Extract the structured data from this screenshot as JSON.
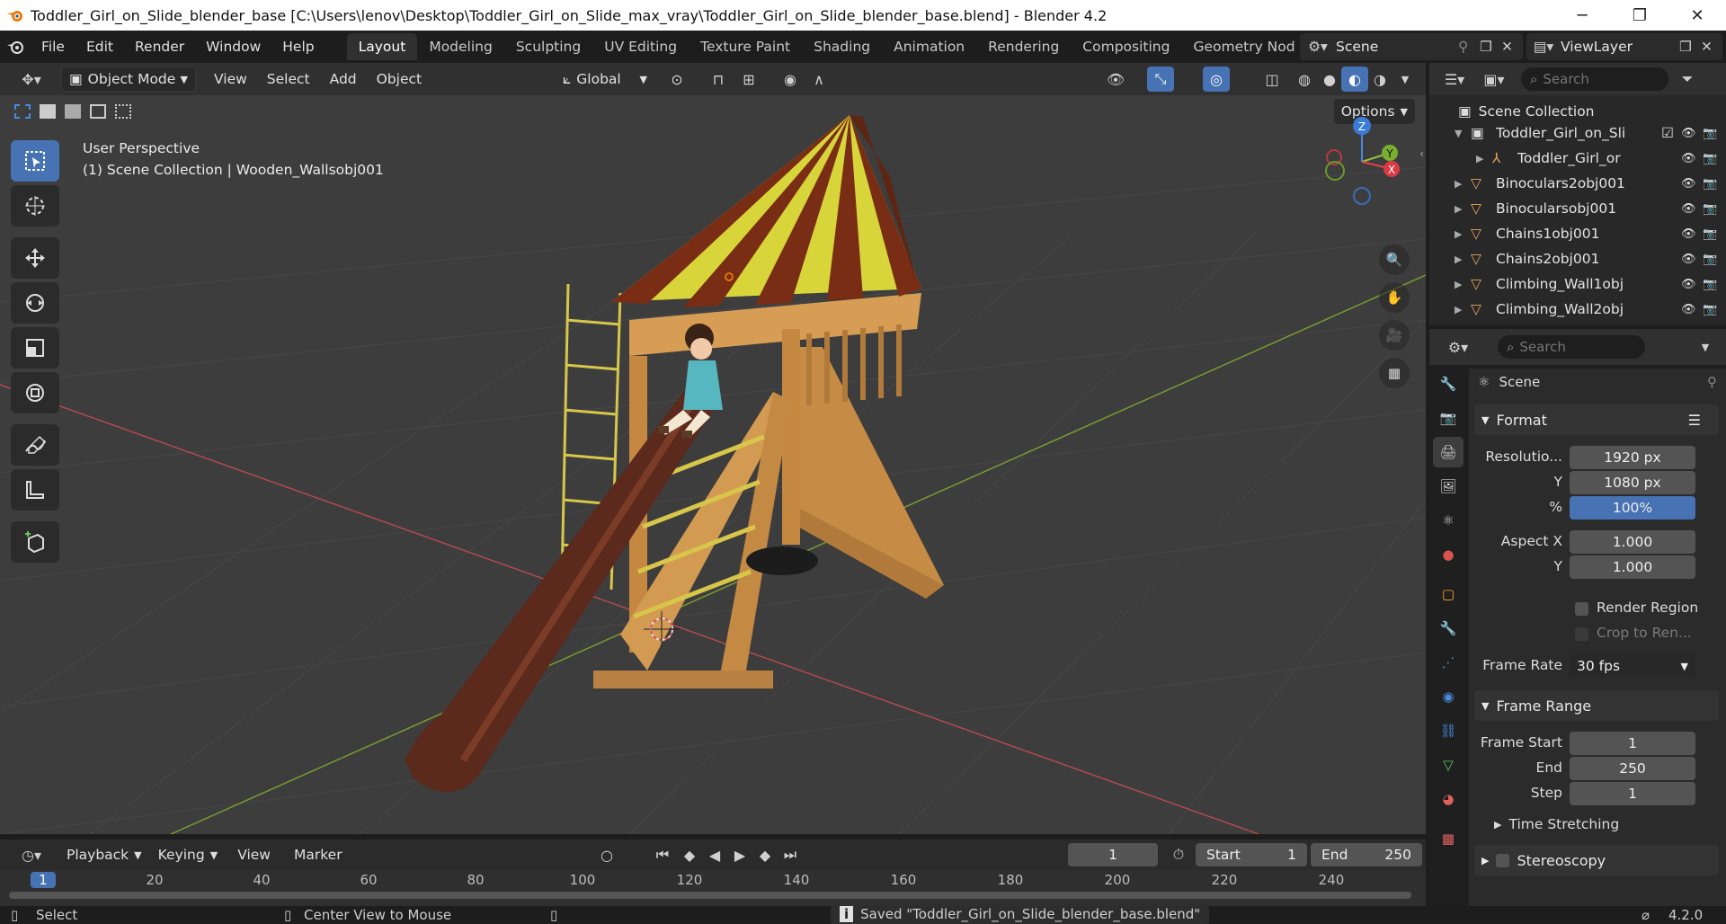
{
  "window": {
    "title": "Toddler_Girl_on_Slide_blender_base [C:\\Users\\lenov\\Desktop\\Toddler_Girl_on_Slide_max_vray\\Toddler_Girl_on_Slide_blender_base.blend] - Blender 4.2",
    "minimize": "─",
    "maximize": "❐",
    "close": "✕"
  },
  "menus": [
    "File",
    "Edit",
    "Render",
    "Window",
    "Help"
  ],
  "workspaces": [
    "Layout",
    "Modeling",
    "Sculpting",
    "UV Editing",
    "Texture Paint",
    "Shading",
    "Animation",
    "Rendering",
    "Compositing",
    "Geometry Nod"
  ],
  "active_workspace": "Layout",
  "scene_name": "Scene",
  "view_layer": "ViewLayer",
  "viewport_header": {
    "mode": "Object Mode",
    "menus": [
      "View",
      "Select",
      "Add",
      "Object"
    ],
    "orientation": "Global",
    "options": "Options"
  },
  "viewport": {
    "perspective": "User Perspective",
    "collection_info": "(1) Scene Collection | Wooden_Wallsobj001",
    "gizmo": {
      "z": "Z",
      "y": "Y",
      "x": "X"
    }
  },
  "outliner": {
    "search_placeholder": "Search",
    "root": "Scene Collection",
    "rows": [
      {
        "label": "Toddler_Girl_on_Sli",
        "depth": 1,
        "type": "collection"
      },
      {
        "label": "Toddler_Girl_or",
        "depth": 2,
        "type": "armature"
      },
      {
        "label": "Binoculars2obj001",
        "depth": 1,
        "type": "mesh"
      },
      {
        "label": "Binocularsobj001",
        "depth": 1,
        "type": "mesh"
      },
      {
        "label": "Chains1obj001",
        "depth": 1,
        "type": "mesh"
      },
      {
        "label": "Chains2obj001",
        "depth": 1,
        "type": "mesh"
      },
      {
        "label": "Climbing_Wall1obj",
        "depth": 1,
        "type": "mesh"
      },
      {
        "label": "Climbing_Wall2obj",
        "depth": 1,
        "type": "mesh"
      }
    ]
  },
  "properties": {
    "search_placeholder": "Search",
    "context": "Scene",
    "format_panel": {
      "title": "Format",
      "resolution_label": "Resolutio...",
      "resolution_x": "1920 px",
      "y_label": "Y",
      "resolution_y": "1080 px",
      "percent_label": "%",
      "percent": "100%",
      "aspect_x_label": "Aspect X",
      "aspect_x": "1.000",
      "aspect_y_label": "Y",
      "aspect_y": "1.000",
      "render_region": "Render Region",
      "crop": "Crop to Ren...",
      "frame_rate_label": "Frame Rate",
      "frame_rate": "30 fps"
    },
    "frame_range_panel": {
      "title": "Frame Range",
      "start_label": "Frame Start",
      "start": "1",
      "end_label": "End",
      "end": "250",
      "step_label": "Step",
      "step": "1"
    },
    "time_stretching": "Time Stretching",
    "stereoscopy": "Stereoscopy"
  },
  "timeline": {
    "menus": [
      "Playback",
      "Keying",
      "View",
      "Marker"
    ],
    "current_frame": "1",
    "start_label": "Start",
    "start": "1",
    "end_label": "End",
    "end": "250",
    "ruler_ticks": [
      "1",
      "20",
      "40",
      "60",
      "80",
      "100",
      "120",
      "140",
      "160",
      "180",
      "200",
      "220",
      "240"
    ]
  },
  "statusbar": {
    "select": "Select",
    "center_view": "Center View to Mouse",
    "message": "Saved \"Toddler_Girl_on_Slide_blender_base.blend\"",
    "version": "4.2.0"
  },
  "colors": {
    "accent": "#4772b3",
    "header": "#303030",
    "viewport_bg": "#3d3d3d",
    "orange_mesh": "#e8a15a"
  },
  "icons": {
    "app": "blender-logo-icon",
    "mode": "cube-icon",
    "outliner_collection": "collection-icon",
    "outliner_mesh": "mesh-triangle-icon",
    "visibility": "eye-icon",
    "render": "camera-icon"
  }
}
